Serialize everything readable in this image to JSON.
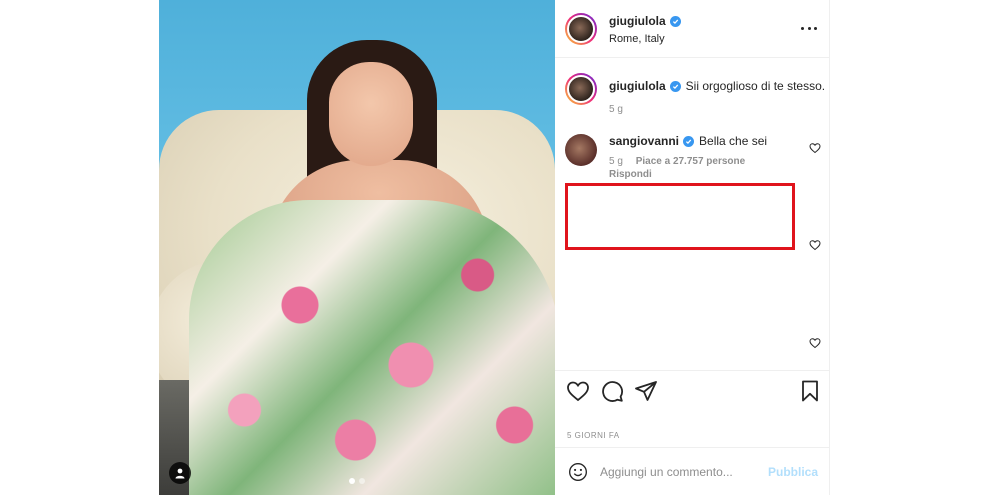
{
  "post": {
    "author": "giugiulola",
    "location": "Rome, Italy",
    "date": "5 giorni fa"
  },
  "caption": {
    "username": "giugiulola",
    "text": "Sii orgoglioso di te stesso.",
    "time": "5 g"
  },
  "comments": [
    {
      "username": "sangiovanni",
      "text": "Bella che sei",
      "time": "5 g",
      "likes": "Piace a 27.757 persone",
      "reply_label": "Rispondi",
      "highlighted": true
    }
  ],
  "add_comment": {
    "placeholder": "Aggiungi un commento...",
    "publish_label": "Pubblica"
  },
  "colors": {
    "verified": "#3897f0",
    "highlight": "#e0141c",
    "publish_disabled": "#b2dffc"
  },
  "icons": [
    "more-options-icon",
    "verified-badge-icon",
    "heart-icon",
    "comment-icon",
    "share-icon",
    "bookmark-icon",
    "emoji-icon",
    "user-tag-icon"
  ]
}
